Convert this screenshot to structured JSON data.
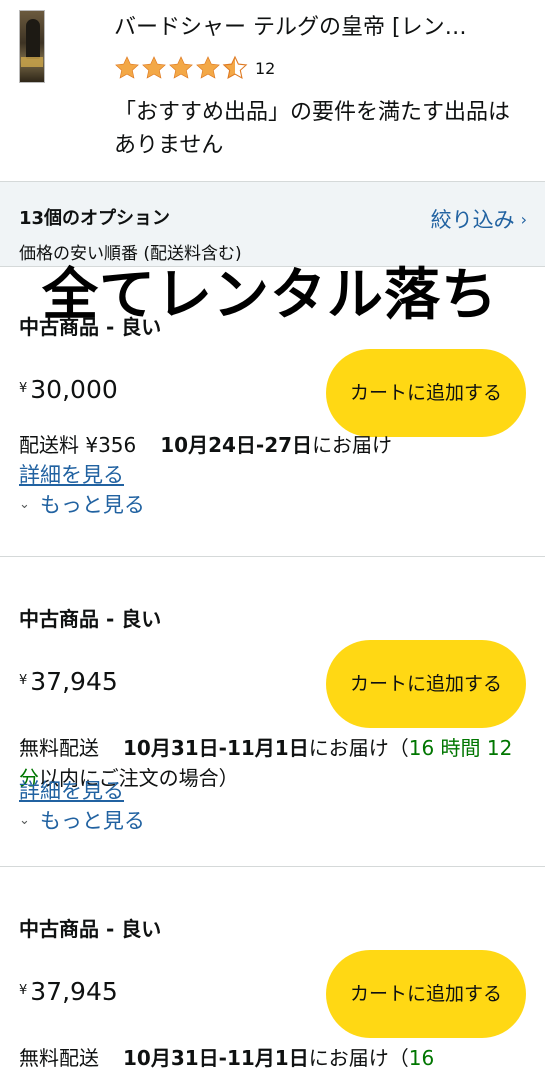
{
  "product": {
    "title": "バードシャー テルグの皇帝 [レン…",
    "rating": 4.5,
    "rating_count": "12",
    "notice": "「おすすめ出品」の要件を満たす出品はありません"
  },
  "options": {
    "count": "13個のオプション",
    "sort": "価格の安い順番 (配送料含む)",
    "filter_label": "絞り込み",
    "filter_icon": "chevron-right-icon"
  },
  "overlay_text": "全てレンタル落ち",
  "offers": [
    {
      "condition": "中古商品 - 良い",
      "currency": "¥",
      "price": "30,000",
      "cart_label": "カートに追加する",
      "shipping": "配送料 ¥356",
      "delivery_date": "10月24日-27日",
      "delivery_suffix": "にお届け",
      "countdown": "",
      "countdown_suffix": "",
      "details_label": "詳細を見る",
      "more_label": "もっと見る"
    },
    {
      "condition": "中古商品 - 良い",
      "currency": "¥",
      "price": "37,945",
      "cart_label": "カートに追加する",
      "shipping": "無料配送",
      "delivery_date": "10月31日-11月1日",
      "delivery_suffix": "にお届け（",
      "countdown": "16 時間 12 分",
      "countdown_suffix": "以内にご注文の場合）",
      "details_label": "詳細を見る",
      "more_label": "もっと見る"
    },
    {
      "condition": "中古商品 - 良い",
      "currency": "¥",
      "price": "37,945",
      "cart_label": "カートに追加する",
      "shipping": "無料配送",
      "delivery_date": "10月31日-11月1日",
      "delivery_suffix": "にお届け（",
      "countdown": "16",
      "countdown_suffix": "",
      "details_label": "",
      "more_label": ""
    }
  ],
  "colors": {
    "link": "#2162a1",
    "button": "#ffd814",
    "star": "#f3a847",
    "countdown": "#007600",
    "options_bg": "#f0f4f6"
  }
}
